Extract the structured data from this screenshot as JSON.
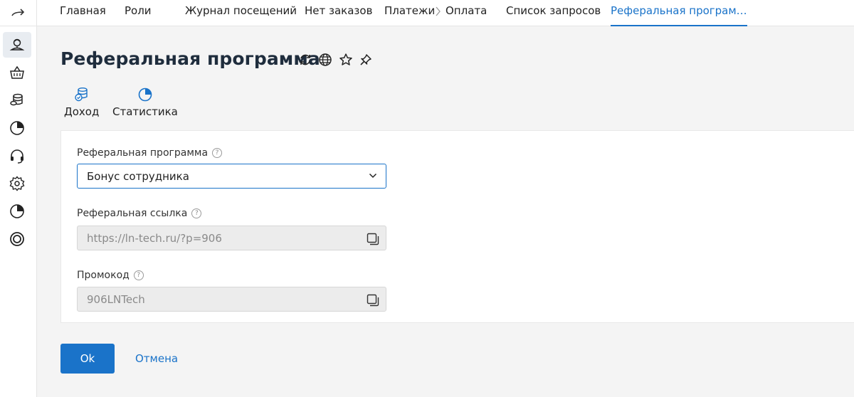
{
  "tabs": [
    {
      "label": "Главная"
    },
    {
      "label": "Роли"
    },
    {
      "label": "Журнал посещений"
    },
    {
      "label": "Нет заказов"
    },
    {
      "label": "Платежи"
    },
    {
      "label": "Оплата"
    },
    {
      "label": "Список запросов"
    },
    {
      "label": "Реферальная програм…"
    }
  ],
  "sidebar": {
    "items": [
      {
        "icon": "user-location-icon",
        "active": true
      },
      {
        "icon": "basket-icon"
      },
      {
        "icon": "coins-icon"
      },
      {
        "icon": "pie-chart-icon"
      },
      {
        "icon": "headset-icon"
      },
      {
        "icon": "gear-icon"
      },
      {
        "icon": "pie-chart-icon"
      },
      {
        "icon": "lifebuoy-icon"
      }
    ]
  },
  "page": {
    "title": "Реферальная программа",
    "title_icons": [
      "refresh-icon",
      "globe-icon",
      "star-icon",
      "pin-icon"
    ]
  },
  "subtabs": [
    {
      "label": "Доход",
      "icon": "coins-check-icon"
    },
    {
      "label": "Статистика",
      "icon": "pie-chart-icon"
    }
  ],
  "form": {
    "program": {
      "label": "Реферальная программа",
      "value": "Бонус сотрудника"
    },
    "link": {
      "label": "Реферальная ссылка",
      "value": "https://ln-tech.ru/?p=906"
    },
    "promo": {
      "label": "Промокод",
      "value": "906LNTech"
    },
    "help_glyph": "?"
  },
  "actions": {
    "ok": "Ok",
    "cancel": "Отмена"
  },
  "colors": {
    "accent": "#1a73c9",
    "title": "#1f2d3d",
    "background": "#f4f4f4"
  }
}
